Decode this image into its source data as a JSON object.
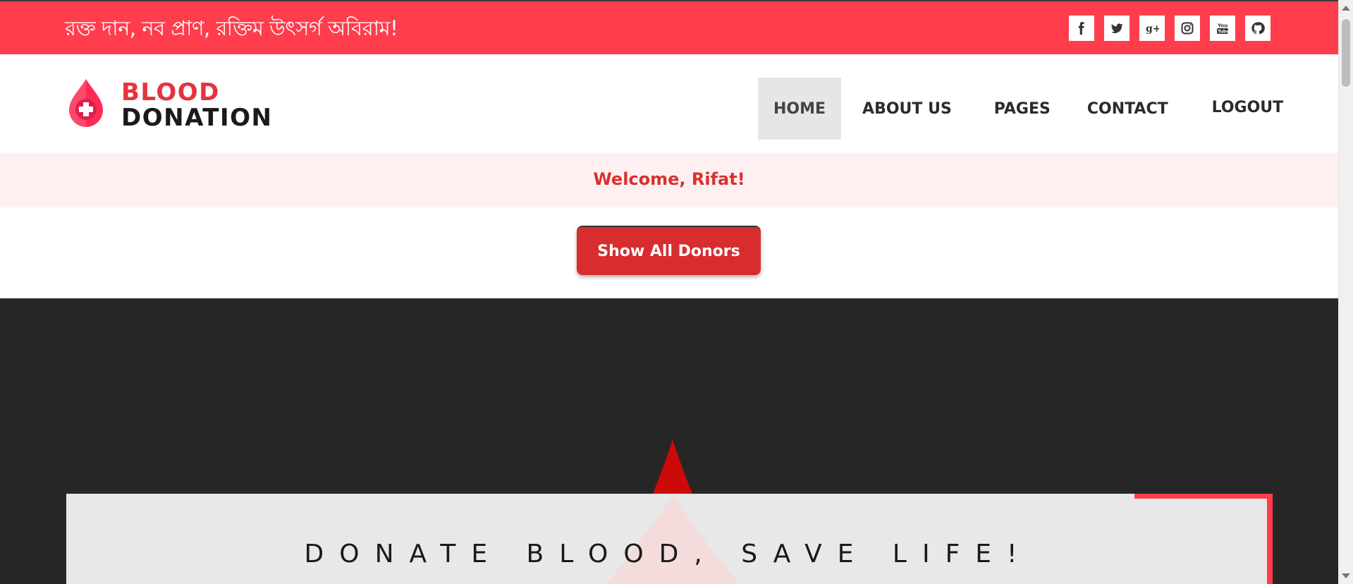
{
  "topbar": {
    "tagline": "রক্ত দান, নব প্রাণ, রক্তিম উৎসর্গ অবিরাম!",
    "background": "#ff3d4d",
    "social": [
      {
        "name": "facebook-icon",
        "glyph": "f"
      },
      {
        "name": "twitter-icon",
        "glyph": "t"
      },
      {
        "name": "google-plus-icon",
        "glyph": "g+"
      },
      {
        "name": "instagram-icon",
        "glyph": "ig"
      },
      {
        "name": "youtube-icon",
        "glyph": "yt"
      },
      {
        "name": "github-icon",
        "glyph": "gh"
      }
    ]
  },
  "logo": {
    "line1": "BLOOD",
    "line2": "DONATION"
  },
  "nav": {
    "home": "HOME",
    "about": "ABOUT US",
    "pages": "PAGES",
    "contact": "CONTACT",
    "logout": "LOGOUT"
  },
  "welcome": {
    "text": "Welcome, Rifat!"
  },
  "actions": {
    "show_donors": "Show All Donors"
  },
  "hero": {
    "title": "DONATE BLOOD, SAVE LIFE!",
    "accent": "#ff3d4d",
    "dark_bg": "#262626"
  }
}
